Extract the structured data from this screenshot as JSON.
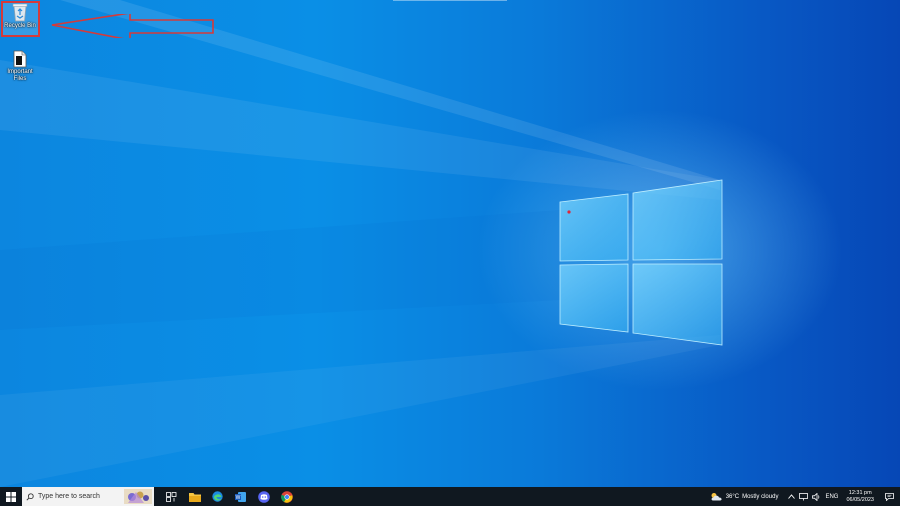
{
  "desktop": {
    "icons": [
      {
        "label": "Recycle Bin",
        "icon": "recycle-bin-icon"
      },
      {
        "label": "Important Files",
        "icon": "file-icon"
      }
    ]
  },
  "taskbar": {
    "search_placeholder": "Type here to search",
    "pinned": [
      "task-view-icon",
      "file-explorer-icon",
      "edge-icon",
      "word-icon",
      "discord-icon",
      "chrome-icon"
    ]
  },
  "tray": {
    "temperature": "36°C",
    "weather": "Mostly cloudy",
    "language": "ENG",
    "time": "12:31 pm",
    "date": "06/05/2023"
  },
  "colors": {
    "annotation": "#d53a3a",
    "taskbar": "#101820"
  }
}
